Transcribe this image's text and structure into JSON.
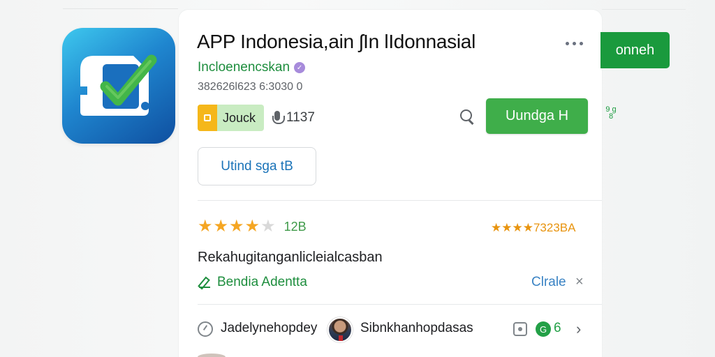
{
  "app": {
    "title": "APP Indonesia,ain ʃIn lIdonnasial",
    "developer": "Incloenencskan",
    "meta": "382626l623 6:3030 0",
    "tag_label": "Jouck",
    "mic_count": "1137",
    "install_label": "Uundga H",
    "top_right_label": "onneh",
    "side_glyphs": "9 g\n8",
    "secondary_button_label": "Utind sga tB"
  },
  "rating": {
    "stars_filled": 4,
    "stars_total": 5,
    "count_left": "12B",
    "right_text": "★★★★7323BA"
  },
  "description": {
    "text": "Rekahugitanganlicleialcasban",
    "edit_label": "Bendia Adentta",
    "close_label": "Clrale",
    "close_glyph": "×"
  },
  "bottom": {
    "author": "Jadelynehopdey",
    "text": "Sibnkhanhopdasas",
    "badge_text": "6",
    "chevron": "›"
  },
  "colors": {
    "primary_green": "#3fae4a",
    "dark_green": "#1a9a3d",
    "link_green": "#1e8e3e",
    "star": "#f5a623",
    "link_blue": "#1a73b8",
    "icon_gradient_start": "#3ec8ee",
    "icon_gradient_end": "#0f4fa0"
  },
  "icons": {
    "app_icon": "checkbox-check-icon",
    "more": "more-horizontal-icon",
    "verified": "verified-badge-icon",
    "search": "search-icon",
    "mic": "mic-icon",
    "edit": "edit-icon",
    "history": "history-icon",
    "camera": "camera-icon",
    "chevron": "chevron-right-icon"
  }
}
